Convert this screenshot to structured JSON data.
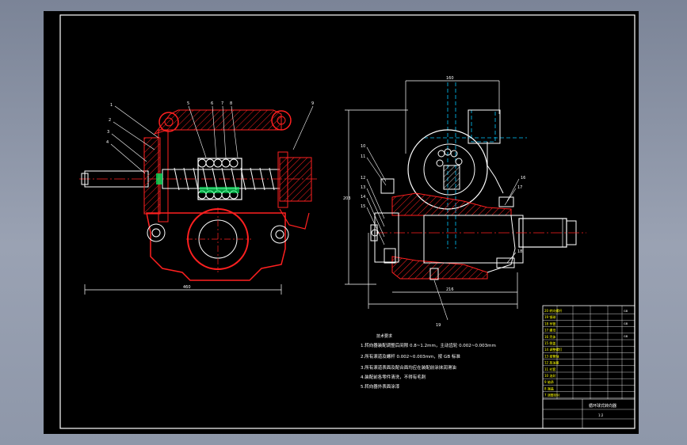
{
  "drawing": {
    "title": "",
    "notes": {
      "heading": "技术要求",
      "lines": [
        "1.转向器装配调整后间隙 0.8~1.2mm，主动齿轮 0.002~0.003mm",
        "2.所有滚道及螺杆 0.002~0.003mm，按 GB 标准",
        "3.所有滚道表面及配合面均应在装配前涂抹润滑油",
        "4.装配前各零件清洗，不得有毛刺",
        "5.转向器外表面涂漆"
      ]
    },
    "part_callouts_left": [
      "1",
      "2",
      "3",
      "4",
      "5",
      "6",
      "7",
      "8",
      "9"
    ],
    "part_callouts_right": [
      "10",
      "11",
      "12",
      "13",
      "14",
      "15",
      "16",
      "17",
      "18",
      "19",
      "20"
    ],
    "dimensions": {
      "left_overall": "460",
      "right_top": "160",
      "right_height": "203",
      "right_bottom": "216"
    },
    "title_block": {
      "rows": [
        "20 转向螺杆",
        "19 钢球",
        "18 导管",
        "17 螺母",
        "16 壳体",
        "15 侧盖",
        "14 调整螺钉",
        "13 摇臂轴",
        "12 放油塞",
        "11 衬套",
        "10 油封",
        "9 轴承",
        "8 端盖",
        "7 调整垫片"
      ],
      "right_codes": [
        "GB",
        "GB",
        "GB"
      ],
      "name": "循环球式转向器",
      "scale": "1:2"
    }
  },
  "colors": {
    "background": "#000000",
    "frame": "#ffffff",
    "housing": "#ff2020",
    "centerline": "#ff2020",
    "hidden": "#00c8ff",
    "text": "#ffff00",
    "hatch": "#00ff66"
  }
}
